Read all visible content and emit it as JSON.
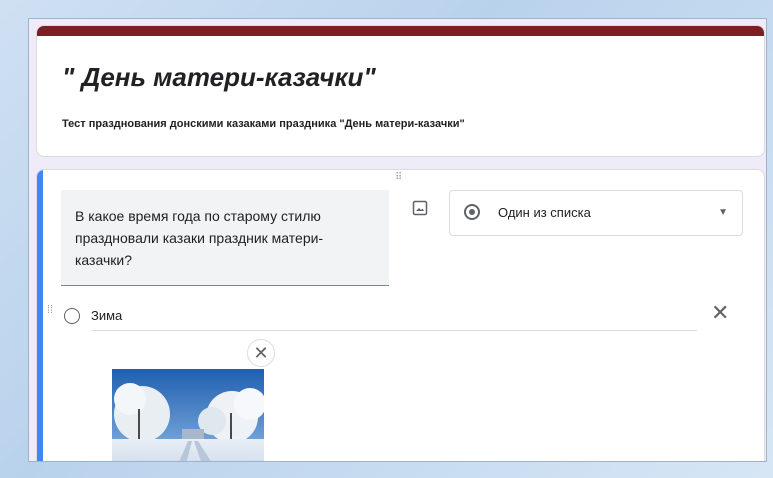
{
  "form": {
    "title": "\" День матери-казачки\"",
    "description": "Тест празднования донскими казаками праздника \"День матери-казачки\"",
    "accent_color": "#7b1f22"
  },
  "question": {
    "text": "В какое время года по старому стилю праздновали казаки праздник матери-казачки?",
    "type_label": "Один из списка",
    "options": [
      {
        "label": "Зима",
        "has_image": true
      }
    ],
    "accent_color": "#4285f4"
  },
  "icons": {
    "drag_handle": "drag-dots-icon",
    "image": "image-icon",
    "radio": "radio-icon",
    "dropdown": "dropdown-arrow-icon",
    "remove": "close-icon"
  }
}
